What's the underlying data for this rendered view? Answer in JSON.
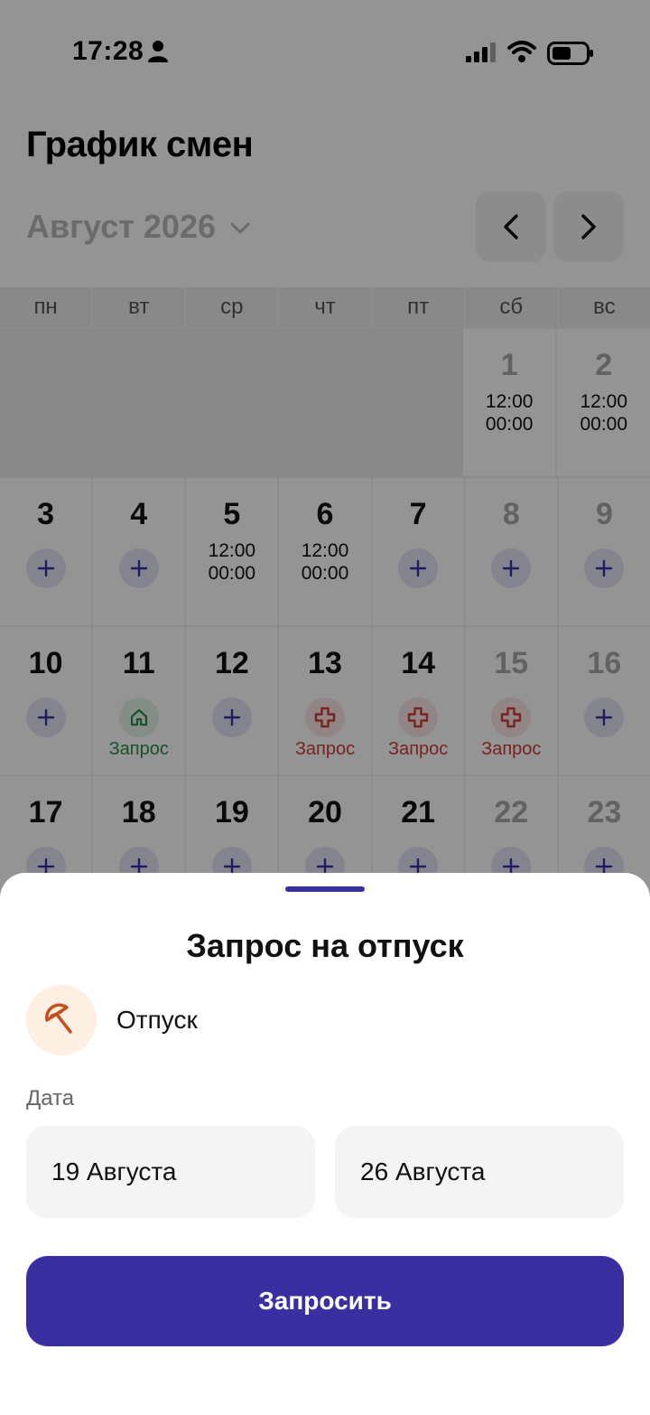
{
  "status_bar": {
    "time": "17:28"
  },
  "header": {
    "title": "График смен"
  },
  "month_selector": {
    "label": "Август 2026"
  },
  "weekdays": [
    "пн",
    "вт",
    "ср",
    "чт",
    "пт",
    "сб",
    "вс"
  ],
  "weeks": [
    [
      {
        "empty": true
      },
      {
        "empty": true
      },
      {
        "empty": true
      },
      {
        "empty": true
      },
      {
        "empty": true
      },
      {
        "day": "1",
        "weekend": true,
        "shift": [
          "12:00",
          "00:00"
        ]
      },
      {
        "day": "2",
        "weekend": true,
        "shift": [
          "12:00",
          "00:00"
        ]
      }
    ],
    [
      {
        "day": "3",
        "add": true
      },
      {
        "day": "4",
        "add": true
      },
      {
        "day": "5",
        "shift": [
          "12:00",
          "00:00"
        ]
      },
      {
        "day": "6",
        "shift": [
          "12:00",
          "00:00"
        ]
      },
      {
        "day": "7",
        "add": true
      },
      {
        "day": "8",
        "weekend": true,
        "add": true
      },
      {
        "day": "9",
        "weekend": true,
        "add": true
      }
    ],
    [
      {
        "day": "10",
        "add": true
      },
      {
        "day": "11",
        "request": {
          "kind": "home-icon",
          "color": "green",
          "label": "Запрос"
        }
      },
      {
        "day": "12",
        "add": true
      },
      {
        "day": "13",
        "request": {
          "kind": "medical-cross-icon",
          "color": "red",
          "label": "Запрос"
        }
      },
      {
        "day": "14",
        "request": {
          "kind": "medical-cross-icon",
          "color": "red",
          "label": "Запрос"
        }
      },
      {
        "day": "15",
        "weekend": true,
        "request": {
          "kind": "medical-cross-icon",
          "color": "red",
          "label": "Запрос"
        }
      },
      {
        "day": "16",
        "weekend": true,
        "add": true
      }
    ],
    [
      {
        "day": "17",
        "add": true
      },
      {
        "day": "18",
        "add": true
      },
      {
        "day": "19",
        "add": true
      },
      {
        "day": "20",
        "add": true
      },
      {
        "day": "21",
        "add": true
      },
      {
        "day": "22",
        "weekend": true,
        "add": true
      },
      {
        "day": "23",
        "weekend": true,
        "add": true
      }
    ]
  ],
  "sheet": {
    "title": "Запрос на отпуск",
    "type_label": "Отпуск",
    "type_icon": "umbrella-icon",
    "date_label": "Дата",
    "date_from": "19 Августа",
    "date_to": "26 Августа",
    "submit_label": "Запросить"
  },
  "colors": {
    "accent": "#3a2fa0",
    "request_green": "#2e8b4b",
    "request_red": "#d13b3b",
    "vacation_orange": "#c4501f"
  }
}
